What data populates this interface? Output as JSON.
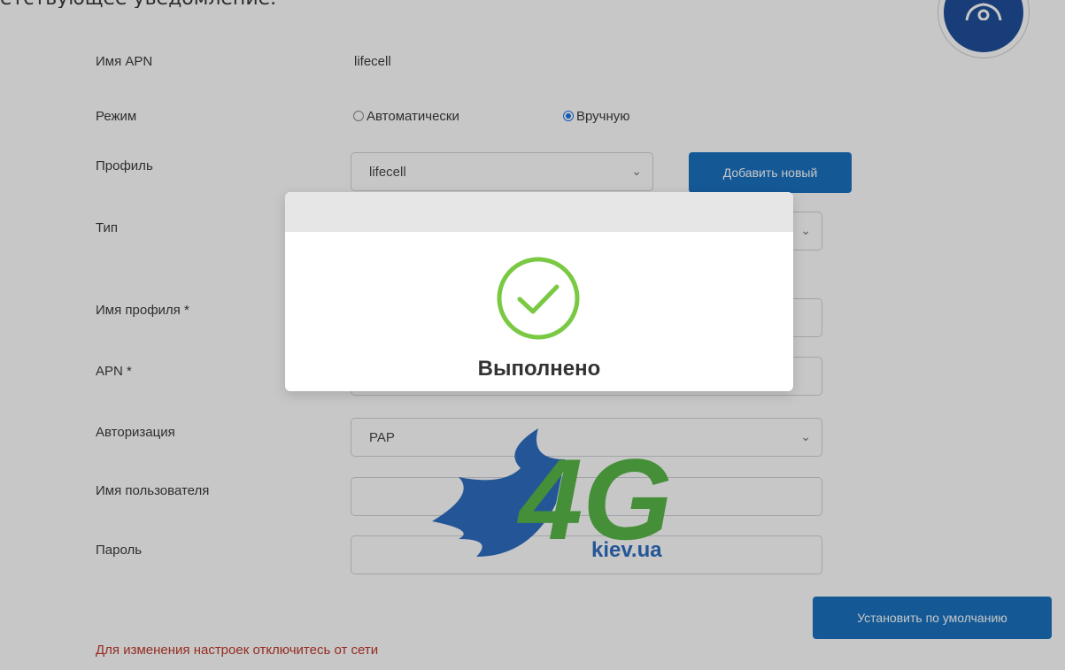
{
  "top_snippet": "етствующее уведомление.",
  "form": {
    "apn_name_label": "Имя APN",
    "apn_name_value": "lifecell",
    "mode_label": "Режим",
    "mode_auto": "Автоматически",
    "mode_manual": "Вручную",
    "profile_label": "Профиль",
    "profile_value": "lifecell",
    "add_new_button": "Добавить новый",
    "type_label": "Тип",
    "profile_name_label": "Имя профиля *",
    "apn_label": "APN *",
    "auth_label": "Авторизация",
    "auth_value": "PAP",
    "username_label": "Имя пользователя",
    "password_label": "Пароль",
    "set_default_button": "Установить по умолчанию",
    "warning": "Для изменения настроек отключитесь от сети"
  },
  "watermark": {
    "site": "kiev.ua"
  },
  "modal": {
    "message": "Выполнено"
  },
  "colors": {
    "accent": "#1a73c0",
    "success": "#7ac943",
    "warning": "#c0392b"
  }
}
